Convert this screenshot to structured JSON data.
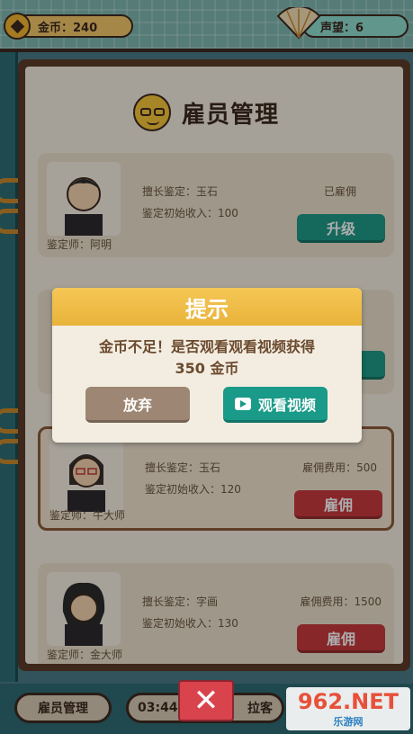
{
  "topbar": {
    "coins_label": "金币：240",
    "fame_label": "声望：6"
  },
  "panel": {
    "title": "雇员管理"
  },
  "cards": [
    {
      "specialty": "擅长鉴定：玉石",
      "initial_income": "鉴定初始收入：100",
      "status": "已雇佣",
      "button": "升级",
      "name": "鉴定师：阿明"
    },
    {
      "specialty": "擅长鉴定：玉石",
      "initial_income": "鉴定初始收入：120",
      "status": "雇佣费用：500",
      "button": "雇佣",
      "name": "鉴定师：牛大师"
    },
    {
      "specialty": "擅长鉴定：字画",
      "initial_income": "鉴定初始收入：130",
      "status": "雇佣费用：1500",
      "button": "雇佣",
      "name": "鉴定师：金大师"
    }
  ],
  "dialog": {
    "title": "提示",
    "message_line1": "金币不足！是否观看观看视频获得",
    "message_line2": "350 金币",
    "abandon_label": "放弃",
    "watch_label": "观看视频"
  },
  "bottombar": {
    "employee_label": "雇员管理",
    "timer_label": "03:44",
    "solicit_label": "拉客",
    "close_glyph": "✕"
  },
  "watermark": {
    "main": "962.NET",
    "sub": "乐游网"
  },
  "colors": {
    "accent_green": "#1f9a88",
    "accent_red": "#c73a3f",
    "dialog_header": "#f6c756"
  }
}
